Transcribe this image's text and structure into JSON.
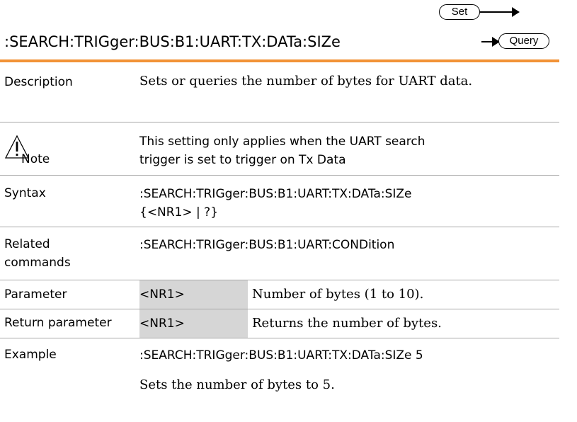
{
  "header": {
    "command": ":SEARCH:TRIGger:BUS:B1:UART:TX:DATa:SIZe",
    "set_label": "Set",
    "query_label": "Query"
  },
  "rows": {
    "description": {
      "label": "Description",
      "text": "Sets or queries the number of bytes for UART data."
    },
    "note": {
      "label": "Note",
      "text": "This setting only applies when the UART search trigger is set to trigger on Tx Data"
    },
    "syntax": {
      "label": "Syntax",
      "line1": ":SEARCH:TRIGger:BUS:B1:UART:TX:DATa:SIZe",
      "line2": "{<NR1> | ?}"
    },
    "related": {
      "label_line1": "Related",
      "label_line2": "commands",
      "text": ":SEARCH:TRIGger:BUS:B1:UART:CONDition"
    },
    "parameter": {
      "label": "Parameter",
      "name": "<NR1>",
      "text": "Number of bytes (1 to 10)."
    },
    "return_parameter": {
      "label": "Return parameter",
      "name": "<NR1>",
      "text": "Returns the number of bytes."
    },
    "example": {
      "label": "Example",
      "command": ":SEARCH:TRIGger:BUS:B1:UART:TX:DATa:SIZe 5",
      "text": "Sets the number of bytes to 5."
    }
  },
  "icons": {
    "note": "warning-triangle-icon"
  },
  "colors": {
    "accent_rule": "#f29236",
    "param_cell": "#d6d6d6"
  }
}
